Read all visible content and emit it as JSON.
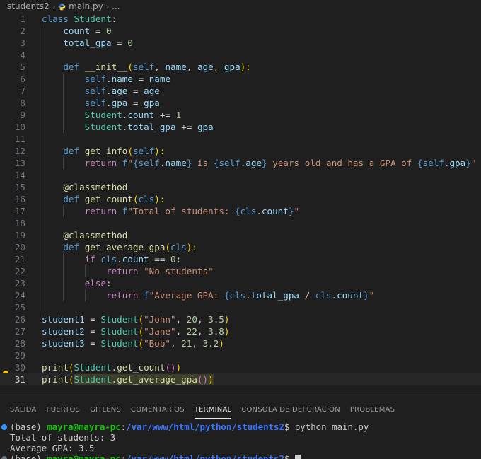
{
  "breadcrumb": {
    "folder": "students2",
    "file": "main.py",
    "tail": "..."
  },
  "editor": {
    "line_numbers": [
      "1",
      "2",
      "3",
      "4",
      "5",
      "6",
      "7",
      "8",
      "9",
      "10",
      "11",
      "12",
      "13",
      "14",
      "15",
      "16",
      "17",
      "18",
      "19",
      "20",
      "21",
      "22",
      "23",
      "24",
      "25",
      "26",
      "27",
      "28",
      "29",
      "30",
      "31"
    ],
    "current_line": "31",
    "lines": [
      [
        [
          "kw",
          "class "
        ],
        [
          "cls",
          "Student"
        ],
        [
          "plain",
          ":"
        ]
      ],
      [
        [
          "plain",
          "    "
        ],
        [
          "var",
          "count"
        ],
        [
          "plain",
          " = "
        ],
        [
          "num",
          "0"
        ]
      ],
      [
        [
          "plain",
          "    "
        ],
        [
          "var",
          "total_gpa"
        ],
        [
          "plain",
          " = "
        ],
        [
          "num",
          "0"
        ]
      ],
      [],
      [
        [
          "plain",
          "    "
        ],
        [
          "kw",
          "def "
        ],
        [
          "fn",
          "__init__"
        ],
        [
          "br1",
          "("
        ],
        [
          "self",
          "self"
        ],
        [
          "plain",
          ", "
        ],
        [
          "var",
          "name"
        ],
        [
          "plain",
          ", "
        ],
        [
          "var",
          "age"
        ],
        [
          "plain",
          ", "
        ],
        [
          "var",
          "gpa"
        ],
        [
          "br1",
          "):"
        ]
      ],
      [
        [
          "plain",
          "        "
        ],
        [
          "self",
          "self"
        ],
        [
          "plain",
          "."
        ],
        [
          "var",
          "name"
        ],
        [
          "plain",
          " = "
        ],
        [
          "var",
          "name"
        ]
      ],
      [
        [
          "plain",
          "        "
        ],
        [
          "self",
          "self"
        ],
        [
          "plain",
          "."
        ],
        [
          "var",
          "age"
        ],
        [
          "plain",
          " = "
        ],
        [
          "var",
          "age"
        ]
      ],
      [
        [
          "plain",
          "        "
        ],
        [
          "self",
          "self"
        ],
        [
          "plain",
          "."
        ],
        [
          "var",
          "gpa"
        ],
        [
          "plain",
          " = "
        ],
        [
          "var",
          "gpa"
        ]
      ],
      [
        [
          "plain",
          "        "
        ],
        [
          "cls",
          "Student"
        ],
        [
          "plain",
          "."
        ],
        [
          "var",
          "count"
        ],
        [
          "plain",
          " += "
        ],
        [
          "num",
          "1"
        ]
      ],
      [
        [
          "plain",
          "        "
        ],
        [
          "cls",
          "Student"
        ],
        [
          "plain",
          "."
        ],
        [
          "var",
          "total_gpa"
        ],
        [
          "plain",
          " += "
        ],
        [
          "var",
          "gpa"
        ]
      ],
      [],
      [
        [
          "plain",
          "    "
        ],
        [
          "kw",
          "def "
        ],
        [
          "fn",
          "get_info"
        ],
        [
          "br1",
          "("
        ],
        [
          "self",
          "self"
        ],
        [
          "br1",
          "):"
        ]
      ],
      [
        [
          "plain",
          "        "
        ],
        [
          "ctl",
          "return "
        ],
        [
          "kw",
          "f"
        ],
        [
          "str",
          "\""
        ],
        [
          "kw",
          "{"
        ],
        [
          "self",
          "self"
        ],
        [
          "plain",
          "."
        ],
        [
          "var",
          "name"
        ],
        [
          "kw",
          "}"
        ],
        [
          "str",
          " is "
        ],
        [
          "kw",
          "{"
        ],
        [
          "self",
          "self"
        ],
        [
          "plain",
          "."
        ],
        [
          "var",
          "age"
        ],
        [
          "kw",
          "}"
        ],
        [
          "str",
          " years old and has a GPA of "
        ],
        [
          "kw",
          "{"
        ],
        [
          "self",
          "self"
        ],
        [
          "plain",
          "."
        ],
        [
          "var",
          "gpa"
        ],
        [
          "kw",
          "}"
        ],
        [
          "str",
          "\""
        ]
      ],
      [],
      [
        [
          "plain",
          "    "
        ],
        [
          "dec",
          "@classmethod"
        ]
      ],
      [
        [
          "plain",
          "    "
        ],
        [
          "kw",
          "def "
        ],
        [
          "fn",
          "get_count"
        ],
        [
          "br1",
          "("
        ],
        [
          "self",
          "cls"
        ],
        [
          "br1",
          "):"
        ]
      ],
      [
        [
          "plain",
          "        "
        ],
        [
          "ctl",
          "return "
        ],
        [
          "kw",
          "f"
        ],
        [
          "str",
          "\"Total of students: "
        ],
        [
          "kw",
          "{"
        ],
        [
          "self",
          "cls"
        ],
        [
          "plain",
          "."
        ],
        [
          "var",
          "count"
        ],
        [
          "kw",
          "}"
        ],
        [
          "str",
          "\""
        ]
      ],
      [],
      [
        [
          "plain",
          "    "
        ],
        [
          "dec",
          "@classmethod"
        ]
      ],
      [
        [
          "plain",
          "    "
        ],
        [
          "kw",
          "def "
        ],
        [
          "fn",
          "get_average_gpa"
        ],
        [
          "br1",
          "("
        ],
        [
          "self",
          "cls"
        ],
        [
          "br1",
          "):"
        ]
      ],
      [
        [
          "plain",
          "        "
        ],
        [
          "ctl",
          "if "
        ],
        [
          "self",
          "cls"
        ],
        [
          "plain",
          "."
        ],
        [
          "var",
          "count"
        ],
        [
          "plain",
          " == "
        ],
        [
          "num",
          "0"
        ],
        [
          "plain",
          ":"
        ]
      ],
      [
        [
          "plain",
          "            "
        ],
        [
          "ctl",
          "return "
        ],
        [
          "str",
          "\"No students\""
        ]
      ],
      [
        [
          "plain",
          "        "
        ],
        [
          "ctl",
          "else"
        ],
        [
          "plain",
          ":"
        ]
      ],
      [
        [
          "plain",
          "            "
        ],
        [
          "ctl",
          "return "
        ],
        [
          "kw",
          "f"
        ],
        [
          "str",
          "\"Average GPA: "
        ],
        [
          "kw",
          "{"
        ],
        [
          "self",
          "cls"
        ],
        [
          "plain",
          "."
        ],
        [
          "var",
          "total_gpa"
        ],
        [
          "plain",
          " / "
        ],
        [
          "self",
          "cls"
        ],
        [
          "plain",
          "."
        ],
        [
          "var",
          "count"
        ],
        [
          "kw",
          "}"
        ],
        [
          "str",
          "\""
        ]
      ],
      [],
      [
        [
          "var",
          "student1"
        ],
        [
          "plain",
          " = "
        ],
        [
          "cls",
          "Student"
        ],
        [
          "br1",
          "("
        ],
        [
          "str",
          "\"John\""
        ],
        [
          "plain",
          ", "
        ],
        [
          "num",
          "20"
        ],
        [
          "plain",
          ", "
        ],
        [
          "num",
          "3.5"
        ],
        [
          "br1",
          ")"
        ]
      ],
      [
        [
          "var",
          "student2"
        ],
        [
          "plain",
          " = "
        ],
        [
          "cls",
          "Student"
        ],
        [
          "br1",
          "("
        ],
        [
          "str",
          "\"Jane\""
        ],
        [
          "plain",
          ", "
        ],
        [
          "num",
          "22"
        ],
        [
          "plain",
          ", "
        ],
        [
          "num",
          "3.8"
        ],
        [
          "br1",
          ")"
        ]
      ],
      [
        [
          "var",
          "student3"
        ],
        [
          "plain",
          " = "
        ],
        [
          "cls",
          "Student"
        ],
        [
          "br1",
          "("
        ],
        [
          "str",
          "\"Bob\""
        ],
        [
          "plain",
          ", "
        ],
        [
          "num",
          "21"
        ],
        [
          "plain",
          ", "
        ],
        [
          "num",
          "3.2"
        ],
        [
          "br1",
          ")"
        ]
      ],
      [],
      [
        [
          "fn",
          "print"
        ],
        [
          "br1",
          "("
        ],
        [
          "cls",
          "Student"
        ],
        [
          "plain",
          "."
        ],
        [
          "fn",
          "get_count"
        ],
        [
          "br2",
          "()"
        ],
        [
          "br1",
          ")"
        ]
      ],
      [
        [
          "fn",
          "print"
        ],
        [
          "br1",
          "("
        ],
        [
          "cls",
          "Student"
        ],
        [
          "plain",
          "."
        ],
        [
          "fn",
          "get_average_gpa"
        ],
        [
          "br2",
          "()"
        ],
        [
          "br1",
          ")"
        ]
      ]
    ]
  },
  "panel": {
    "tabs": [
      {
        "label": "SALIDA",
        "active": false
      },
      {
        "label": "PUERTOS",
        "active": false
      },
      {
        "label": "GITLENS",
        "active": false
      },
      {
        "label": "COMENTARIOS",
        "active": false
      },
      {
        "label": "TERMINAL",
        "active": true
      },
      {
        "label": "CONSOLA DE DEPURACIÓN",
        "active": false
      },
      {
        "label": "PROBLEMAS",
        "active": false
      }
    ]
  },
  "terminal": {
    "prompt_env": "(base) ",
    "prompt_user": "mayra@mayra-pc",
    "prompt_colon": ":",
    "prompt_path": "/var/www/html/python/students2",
    "prompt_dollar": "$ ",
    "command": "python main.py",
    "output_line_1": "Total of students: 3",
    "output_line_2": "Average GPA: 3.5"
  },
  "colors": {
    "background": "#1f1f1f",
    "keyword": "#569cd6",
    "class_name": "#4ec9b0",
    "function": "#dcdcaa",
    "string": "#ce9178",
    "number": "#b5cea8",
    "terminal_user": "#16c60c",
    "terminal_path": "#3b78ff"
  }
}
